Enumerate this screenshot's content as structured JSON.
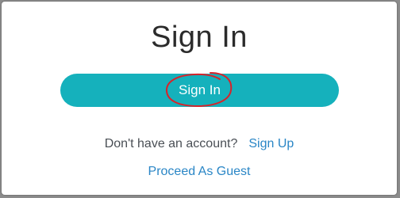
{
  "modal": {
    "title": "Sign In",
    "signin_button_label": "Sign In",
    "account_prompt": "Don't have an account?",
    "signup_link": "Sign Up",
    "guest_link": "Proceed As Guest"
  },
  "colors": {
    "button_bg": "#15b1bc",
    "link": "#2a86c6",
    "annotation": "#d8232a"
  }
}
